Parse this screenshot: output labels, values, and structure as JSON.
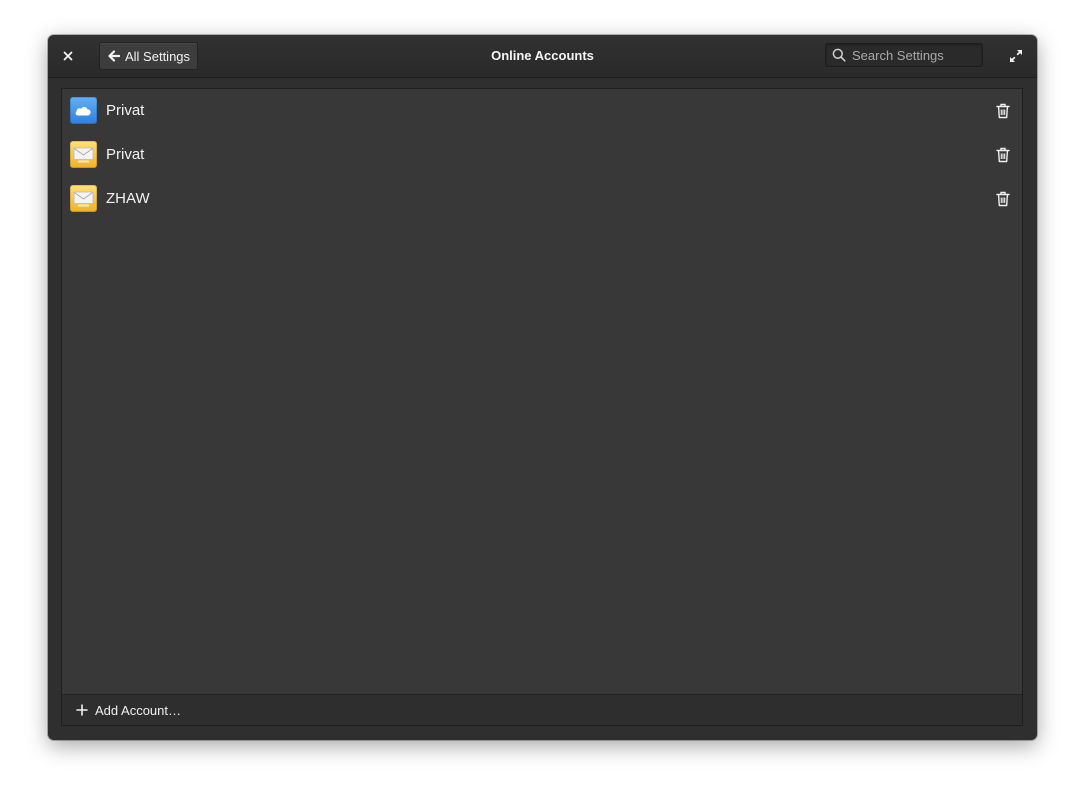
{
  "window": {
    "title": "Online Accounts"
  },
  "header": {
    "back_label": "All Settings",
    "search_placeholder": "Search Settings",
    "search_value": ""
  },
  "accounts": [
    {
      "name": "Privat",
      "icon": "cloud-icon",
      "color": "#3d8ce8"
    },
    {
      "name": "Privat",
      "icon": "mail-icon",
      "color": "#f5b52e"
    },
    {
      "name": "ZHAW",
      "icon": "mail-icon",
      "color": "#f5b52e"
    }
  ],
  "actionbar": {
    "add_label": "Add Account…"
  },
  "colors": {
    "window_bg": "#2f2f2f",
    "content_bg": "#383838",
    "text": "#f2f2f2"
  }
}
